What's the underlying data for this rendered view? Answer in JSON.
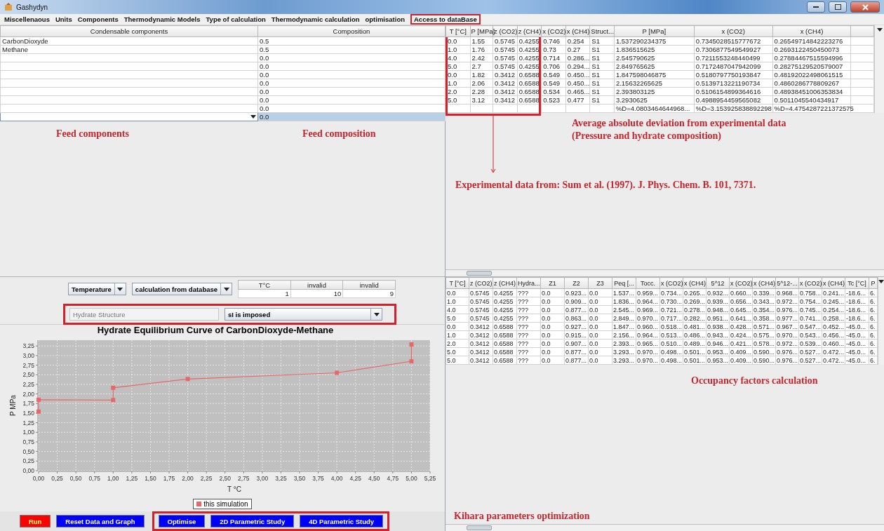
{
  "window": {
    "title": "Gashydyn"
  },
  "menu": [
    {
      "label": "Miscellenaous",
      "highlighted": false
    },
    {
      "label": "Units",
      "highlighted": false
    },
    {
      "label": "Components",
      "highlighted": false
    },
    {
      "label": "Thermodynamic Models",
      "highlighted": false
    },
    {
      "label": "Type of calculation",
      "highlighted": false
    },
    {
      "label": "Thermodynamic calculation",
      "highlighted": false
    },
    {
      "label": "optimisation",
      "highlighted": false
    },
    {
      "label": "Access to dataBase",
      "highlighted": true
    }
  ],
  "feed_table": {
    "columns": [
      "Condensable components",
      "Composition"
    ],
    "rows": [
      {
        "component": "CarbonDioxyde",
        "composition": "0.5",
        "selected": false
      },
      {
        "component": "Methane",
        "composition": "0.5",
        "selected": false
      },
      {
        "composition": "0.0",
        "selected": false
      },
      {
        "composition": "0.0",
        "selected": false
      },
      {
        "composition": "0.0",
        "selected": false
      },
      {
        "composition": "0.0",
        "selected": false
      },
      {
        "composition": "0.0",
        "selected": false
      },
      {
        "composition": "0.0",
        "selected": false
      },
      {
        "composition": "0.0",
        "selected": false
      },
      {
        "composition": "0.0",
        "selected": true
      }
    ]
  },
  "feed_notes": [
    "Feed components",
    "Feed composition"
  ],
  "controls": {
    "variable": "Temperature",
    "mode": "calculation from database",
    "range": {
      "columns": [
        "T°C",
        "invalid",
        "invalid"
      ],
      "values": [
        "1",
        "10",
        "9"
      ]
    },
    "hydrate_structure": {
      "field": "Hydrate Structure",
      "disabled": true,
      "value": "sI is imposed",
      "highlighted": true
    }
  },
  "chart": {
    "chart_data": {
      "type": "line",
      "title": "Hydrate Equilibrium Curve of CarbonDioxyde-Methane",
      "xlabel": "T °C",
      "ylabel": "P MPa",
      "x": [
        0,
        0,
        1,
        1,
        2,
        4,
        5,
        5
      ],
      "series": [
        {
          "name": "this simulation",
          "color": "#e8686a",
          "marker": "square",
          "values": [
            1.54,
            1.85,
            1.84,
            2.16,
            2.39,
            2.55,
            2.85,
            3.29
          ]
        }
      ],
      "grid": true,
      "xlim": [
        0,
        5.25
      ],
      "ylim": [
        0,
        3.4
      ],
      "xticks": [
        {
          "value": 0,
          "label": "0,00"
        },
        {
          "value": 0.25,
          "label": "0,25"
        },
        {
          "value": 0.5,
          "label": "0,50"
        },
        {
          "value": 0.75,
          "label": "0,75"
        },
        {
          "value": 1,
          "label": "1,00"
        },
        {
          "value": 1.25,
          "label": "1,25"
        },
        {
          "value": 1.5,
          "label": "1,50"
        },
        {
          "value": 1.75,
          "label": "1,75"
        },
        {
          "value": 2,
          "label": "2,00"
        },
        {
          "value": 2.25,
          "label": "2,25"
        },
        {
          "value": 2.5,
          "label": "2,50"
        },
        {
          "value": 2.75,
          "label": "2,75"
        },
        {
          "value": 3,
          "label": "3,00"
        },
        {
          "value": 3.25,
          "label": "3,25"
        },
        {
          "value": 3.5,
          "label": "3,50"
        },
        {
          "value": 3.75,
          "label": "3,75"
        },
        {
          "value": 4,
          "label": "4,00"
        },
        {
          "value": 4.25,
          "label": "4,25"
        },
        {
          "value": 4.5,
          "label": "4,50"
        },
        {
          "value": 4.75,
          "label": "4,75"
        },
        {
          "value": 5,
          "label": "5,00"
        },
        {
          "value": 5.25,
          "label": "5,25"
        }
      ],
      "yticks": [
        {
          "value": 0,
          "label": "0,00"
        },
        {
          "value": 0.25,
          "label": "0,25"
        },
        {
          "value": 0.5,
          "label": "0,50"
        },
        {
          "value": 0.75,
          "label": "0,75"
        },
        {
          "value": 1,
          "label": "1,00"
        },
        {
          "value": 1.25,
          "label": "1,25"
        },
        {
          "value": 1.5,
          "label": "1,50"
        },
        {
          "value": 1.75,
          "label": "1,75"
        },
        {
          "value": 2,
          "label": "2,00"
        },
        {
          "value": 2.25,
          "label": "2,25"
        },
        {
          "value": 2.5,
          "label": "2,50"
        },
        {
          "value": 2.75,
          "label": "2,75"
        },
        {
          "value": 3,
          "label": "3,00"
        },
        {
          "value": 3.25,
          "label": "3,25"
        }
      ]
    }
  },
  "button_groups": [
    {
      "highlighted": false,
      "buttons": [
        {
          "label": "Run",
          "color": "#ff0000"
        },
        {
          "label": "Reset Data and Graph",
          "color": "#0000ff"
        }
      ]
    },
    {
      "highlighted": true,
      "buttons": [
        {
          "label": "Optimise",
          "color": "#0000ff"
        },
        {
          "label": "2D Parametric Study",
          "color": "#0000ff"
        },
        {
          "label": "4D Parametric Study",
          "color": "#0000ff"
        }
      ]
    }
  ],
  "experimental_table": {
    "columns": [
      {
        "label": "T [°C]",
        "highlighted": true
      },
      {
        "label": "P [MPa]",
        "highlighted": true
      },
      {
        "label": "z (CO2)",
        "highlighted": true
      },
      {
        "label": "z (CH4)",
        "highlighted": true
      },
      {
        "label": "x (CO2)",
        "highlighted": false
      },
      {
        "label": "x (CH4)",
        "highlighted": false
      },
      {
        "label": "Struct...",
        "highlighted": false
      },
      {
        "label": "P [MPa]",
        "highlighted": false
      },
      {
        "label": "x (CO2)",
        "highlighted": false
      },
      {
        "label": "x (CH4)",
        "highlighted": false
      }
    ],
    "rows": [
      [
        "0.0",
        "1.55",
        "0.5745",
        "0.4255",
        "0.746",
        "0.254",
        "S1",
        "1.537290234375",
        "0.7345028515777672",
        "0.26549714842223276"
      ],
      [
        "1.0",
        "1.76",
        "0.5745",
        "0.4255",
        "0.73",
        "0.27",
        "S1",
        "1.836515625",
        "0.7306877549549927",
        "0.2693122450450073"
      ],
      [
        "4.0",
        "2.42",
        "0.5745",
        "0.4255",
        "0.714",
        "0.286...",
        "S1",
        "2.545790625",
        "0.7211553248440499",
        "0.27884467515594996"
      ],
      [
        "5.0",
        "2.7",
        "0.5745",
        "0.4255",
        "0.706",
        "0.294...",
        "S1",
        "2.849765625",
        "0.7172487047942099",
        "0.28275129520579007"
      ],
      [
        "0.0",
        "1.82",
        "0.3412",
        "0.6588",
        "0.549",
        "0.450...",
        "S1",
        "1.847598046875",
        "0.5180797750193847",
        "0.48192022498061515"
      ],
      [
        "1.0",
        "2.06",
        "0.3412",
        "0.6588",
        "0.549",
        "0.450...",
        "S1",
        "2.15632265625",
        "0.5139713221190734",
        "0.4860286778809267"
      ],
      [
        "2.0",
        "2.28",
        "0.3412",
        "0.6588",
        "0.534",
        "0.465...",
        "S1",
        "2.393803125",
        "0.5106154899364616",
        "0.48938451006353834"
      ],
      [
        "5.0",
        "3.12",
        "0.3412",
        "0.6588",
        "0.523",
        "0.477",
        "S1",
        "3.2930625",
        "0.4988954459565082",
        "0.5011045540434917"
      ]
    ],
    "deviation": [
      "%D=4.0803464644968...",
      "%D=3.153925838892298",
      "%D=4.4754287221372575"
    ]
  },
  "deviation_note": [
    "Average absolute deviation from experimental data",
    "(Pressure and hydrate composition)"
  ],
  "source_note": "Experimental data from: Sum et al. (1997). J. Phys. Chem. B. 101, 7371.",
  "occupancy_table": {
    "columns": [
      "T [°C]",
      "z (CO2)",
      "z (CH4)",
      "Hydra...",
      "Z1",
      "Z2",
      "Z3",
      "Peq [...",
      "Tocc.",
      "x (CO2)",
      "x (CH4)",
      "5^12",
      "x (CO2)",
      "x (CH4)",
      "5^12-...",
      "x (CO2)",
      "x (CH4)",
      "Tc [°C]",
      "P"
    ],
    "rows": [
      [
        "0.0",
        "0.5745",
        "0.4255",
        "???",
        "0.0",
        "0.923...",
        "0.0",
        "1.537...",
        "0.959...",
        "0.734...",
        "0.265...",
        "0.932...",
        "0.660...",
        "0.339...",
        "0.968...",
        "0.758...",
        "0.241...",
        "-18.6...",
        "6."
      ],
      [
        "1.0",
        "0.5745",
        "0.4255",
        "???",
        "0.0",
        "0.909...",
        "0.0",
        "1.836...",
        "0.964...",
        "0.730...",
        "0.269...",
        "0.939...",
        "0.656...",
        "0.343...",
        "0.972...",
        "0.754...",
        "0.245...",
        "-18.6...",
        "6."
      ],
      [
        "4.0",
        "0.5745",
        "0.4255",
        "???",
        "0.0",
        "0.877...",
        "0.0",
        "2.545...",
        "0.969...",
        "0.721...",
        "0.278...",
        "0.948...",
        "0.645...",
        "0.354...",
        "0.976...",
        "0.745...",
        "0.254...",
        "-18.6...",
        "6."
      ],
      [
        "5.0",
        "0.5745",
        "0.4255",
        "???",
        "0.0",
        "0.863...",
        "0.0",
        "2.849...",
        "0.970...",
        "0.717...",
        "0.282...",
        "0.951...",
        "0.641...",
        "0.358...",
        "0.977...",
        "0.741...",
        "0.258...",
        "-18.6...",
        "6."
      ],
      [
        "0.0",
        "0.3412",
        "0.6588",
        "???",
        "0.0",
        "0.927...",
        "0.0",
        "1.847...",
        "0.960...",
        "0.518...",
        "0.481...",
        "0.938...",
        "0.428...",
        "0.571...",
        "0.967...",
        "0.547...",
        "0.452...",
        "-45.0...",
        "6."
      ],
      [
        "1.0",
        "0.3412",
        "0.6588",
        "???",
        "0.0",
        "0.915...",
        "0.0",
        "2.156...",
        "0.964...",
        "0.513...",
        "0.486...",
        "0.943...",
        "0.424...",
        "0.575...",
        "0.970...",
        "0.543...",
        "0.456...",
        "-45.0...",
        "6."
      ],
      [
        "2.0",
        "0.3412",
        "0.6588",
        "???",
        "0.0",
        "0.907...",
        "0.0",
        "2.393...",
        "0.965...",
        "0.510...",
        "0.489...",
        "0.946...",
        "0.421...",
        "0.578...",
        "0.972...",
        "0.539...",
        "0.460...",
        "-45.0...",
        "6."
      ],
      [
        "5.0",
        "0.3412",
        "0.6588",
        "???",
        "0.0",
        "0.877...",
        "0.0",
        "3.293...",
        "0.970...",
        "0.498...",
        "0.501...",
        "0.953...",
        "0.409...",
        "0.590...",
        "0.976...",
        "0.527...",
        "0.472...",
        "-45.0...",
        "6."
      ],
      [
        "5.0",
        "0.3412",
        "0.6588",
        "???",
        "0.0",
        "0.877...",
        "0.0",
        "3.293...",
        "0.970...",
        "0.498...",
        "0.501...",
        "0.953...",
        "0.409...",
        "0.590...",
        "0.976...",
        "0.527...",
        "0.472...",
        "-45.0...",
        "6."
      ]
    ]
  },
  "occupancy_note": "Occupancy factors calculation",
  "optimization_note": "Kihara parameters optimization"
}
